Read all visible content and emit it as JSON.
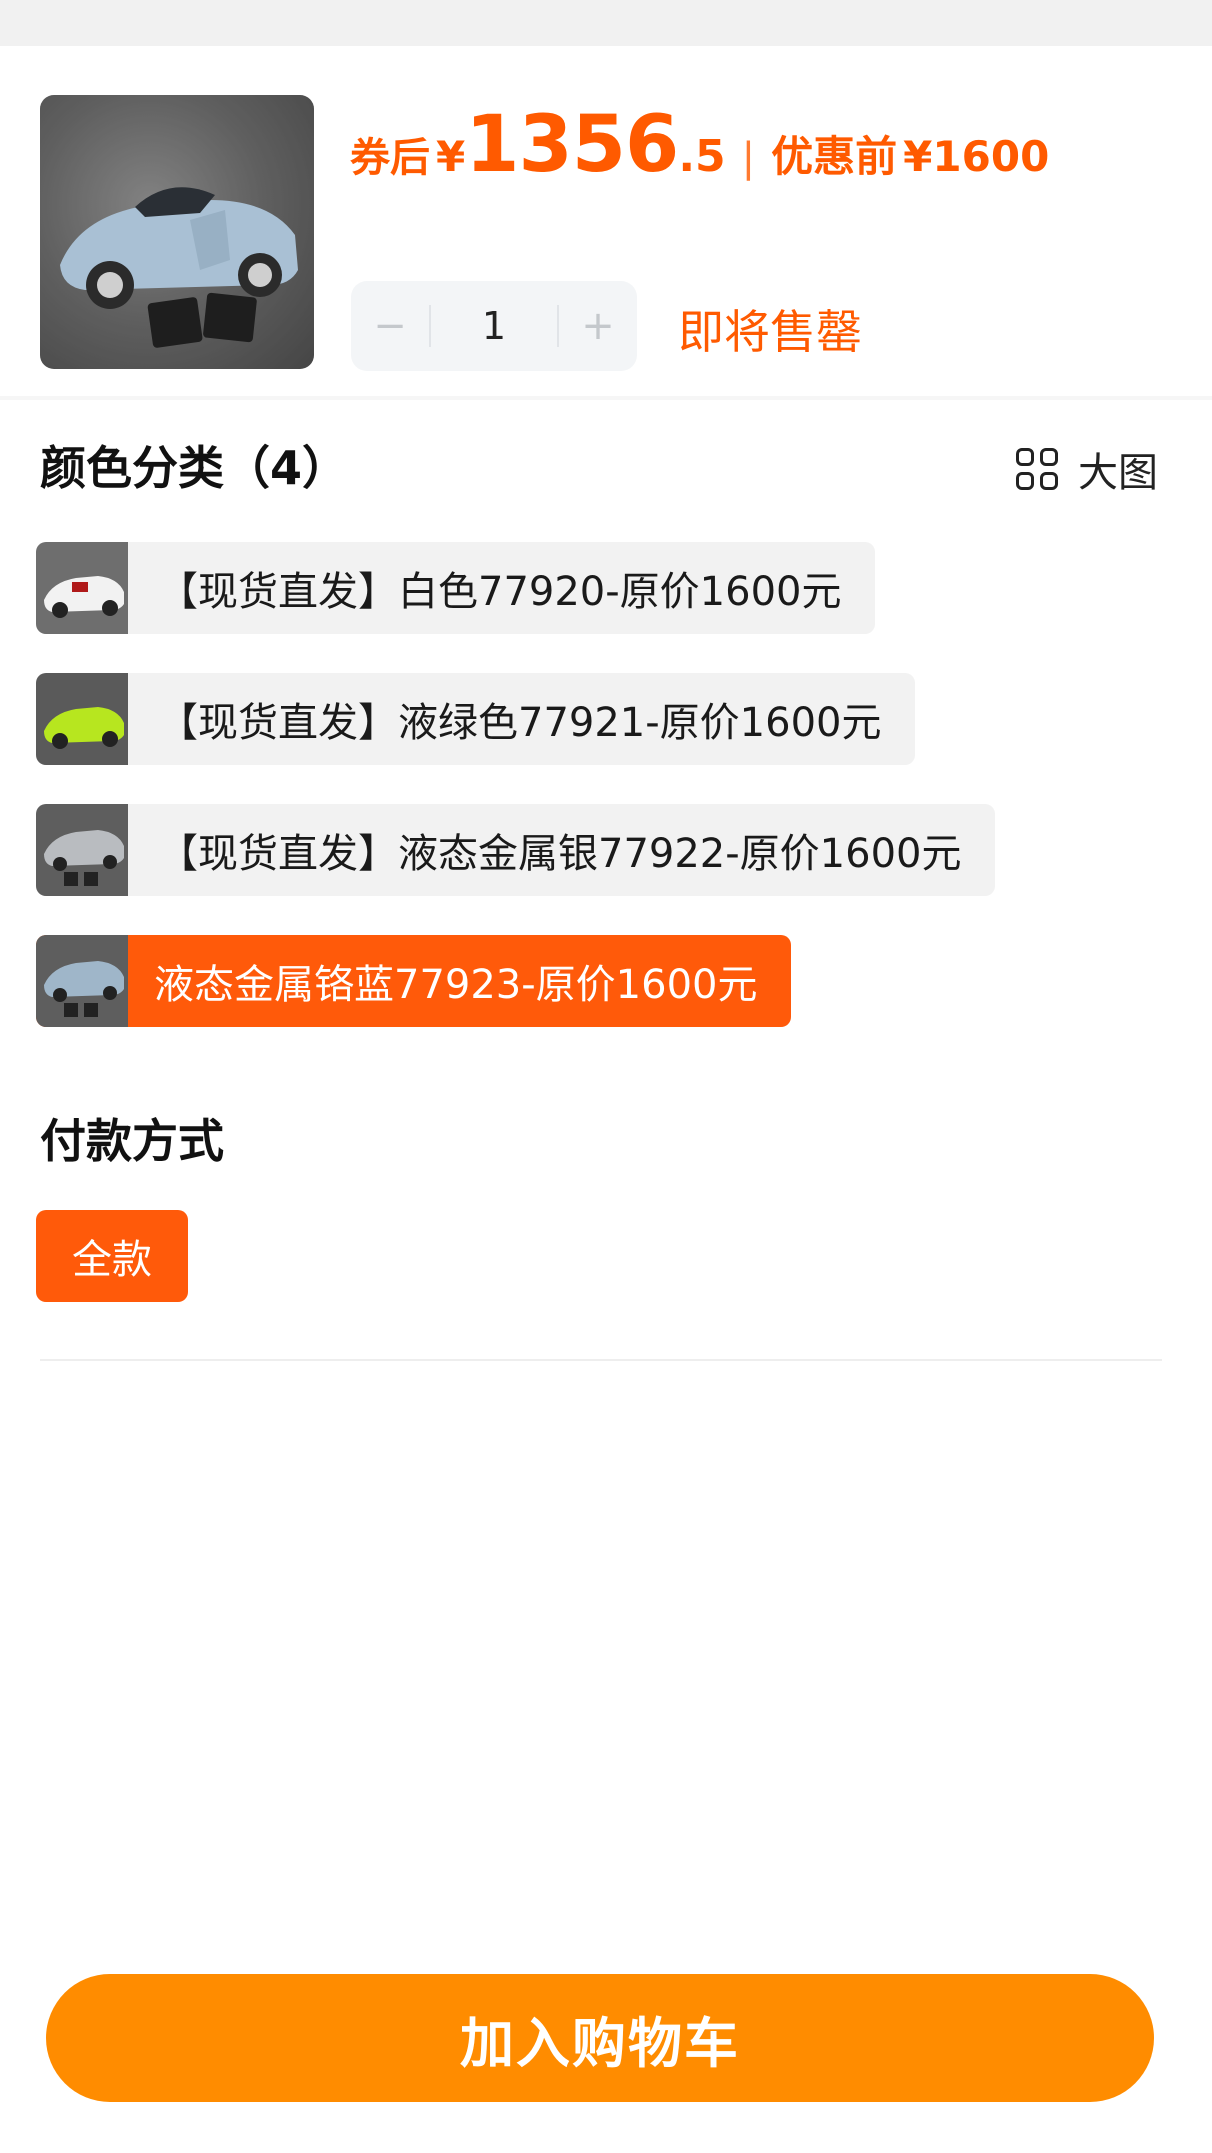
{
  "product": {
    "coupon_label": "券后",
    "currency": "¥",
    "price_int": "1356",
    "price_dec": ".5",
    "divider": "|",
    "original_label": "优惠前",
    "original_price": "1600"
  },
  "quantity": {
    "minus": "−",
    "value": "1",
    "plus": "+"
  },
  "stock_status": "即将售罄",
  "color_section": {
    "title": "颜色分类（4）",
    "big_view_label": "大图",
    "options": [
      {
        "label": "【现货直发】白色77920-原价1600元",
        "selected": false,
        "car_color": "#f2f2f2"
      },
      {
        "label": "【现货直发】液绿色77921-原价1600元",
        "selected": false,
        "car_color": "#b7e61f"
      },
      {
        "label": "【现货直发】液态金属银77922-原价1600元",
        "selected": false,
        "car_color": "#b9bcc0"
      },
      {
        "label": "液态金属铬蓝77923-原价1600元",
        "selected": true,
        "car_color": "#9fb6c9"
      }
    ]
  },
  "payment_section": {
    "title": "付款方式",
    "options": [
      {
        "label": "全款",
        "selected": true
      }
    ]
  },
  "add_to_cart": "加入购物车",
  "colors": {
    "accent": "#ff5a0a",
    "cart_button": "#ff8c00"
  }
}
